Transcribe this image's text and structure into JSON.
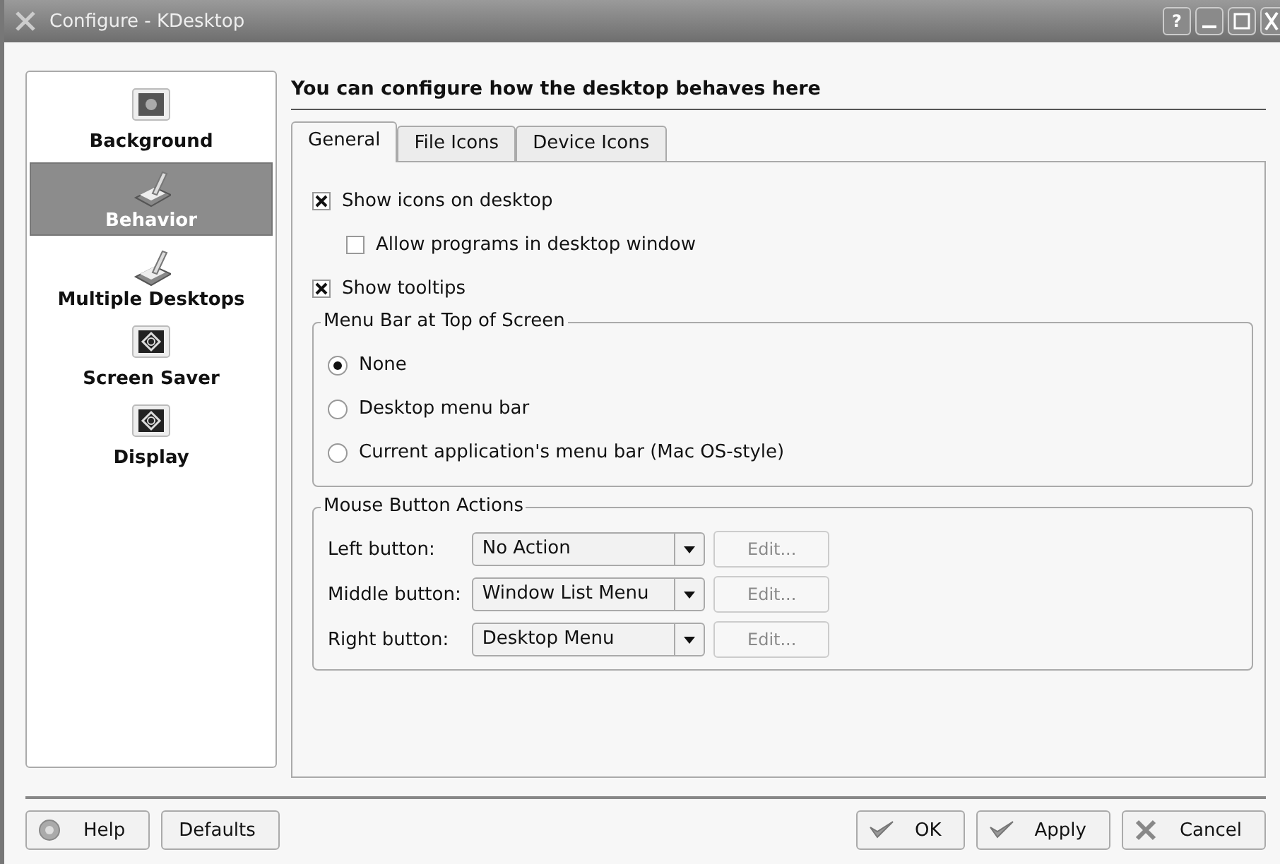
{
  "window": {
    "title": "Configure - KDesktop",
    "buttons": [
      "?"
    ]
  },
  "sidebar": {
    "items": [
      {
        "label": "Background",
        "kind": "wallpaper",
        "selected": false
      },
      {
        "label": "Behavior",
        "kind": "brush",
        "selected": true
      },
      {
        "label": "Multiple Desktops",
        "kind": "brush",
        "selected": false
      },
      {
        "label": "Screen Saver",
        "kind": "monitor",
        "selected": false
      },
      {
        "label": "Display",
        "kind": "monitor",
        "selected": false
      }
    ]
  },
  "heading": "You can configure how the desktop behaves here",
  "tabs": [
    {
      "label": "General",
      "selected": true
    },
    {
      "label": "File Icons",
      "selected": false
    },
    {
      "label": "Device Icons",
      "selected": false
    }
  ],
  "options": [
    {
      "label": "Show icons on desktop",
      "checked": true,
      "indented": false
    },
    {
      "label": "Allow programs in desktop window",
      "checked": false,
      "indented": true
    },
    {
      "label": "Show tooltips",
      "checked": true,
      "indented": false
    }
  ],
  "menu_bar_group": {
    "title": "Menu Bar at Top of Screen",
    "choices": [
      {
        "label": "None",
        "selected": true
      },
      {
        "label": "Desktop menu bar",
        "selected": false
      },
      {
        "label": "Current application's menu bar (Mac OS-style)",
        "selected": false
      }
    ]
  },
  "mouse_group": {
    "title": "Mouse Button Actions",
    "rows": [
      {
        "label": "Left button:",
        "value": "No Action",
        "edit": "Edit...",
        "edit_disabled": true
      },
      {
        "label": "Middle button:",
        "value": "Window List Menu",
        "edit": "Edit...",
        "edit_disabled": true
      },
      {
        "label": "Right button:",
        "value": "Desktop Menu",
        "edit": "Edit...",
        "edit_disabled": true
      }
    ]
  },
  "footer": {
    "left": [
      {
        "label": "Help",
        "kind": "help"
      },
      {
        "label": "Defaults",
        "kind": "plain"
      }
    ],
    "right": [
      {
        "label": "OK",
        "kind": "check"
      },
      {
        "label": "Apply",
        "kind": "check"
      },
      {
        "label": "Cancel",
        "kind": "cross"
      }
    ]
  }
}
